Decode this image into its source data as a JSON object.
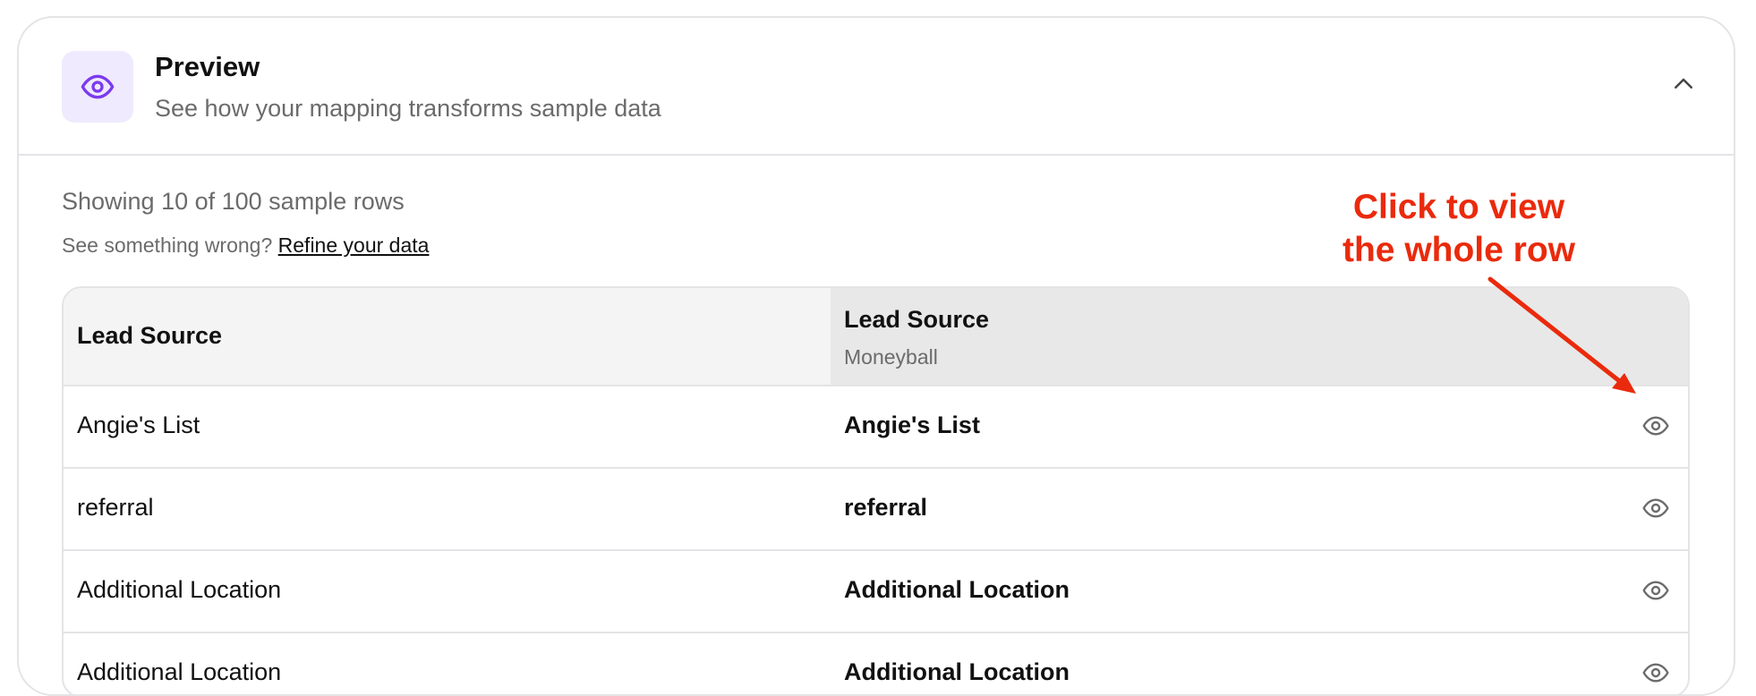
{
  "header": {
    "icon": "eye-icon",
    "title": "Preview",
    "subtitle": "See how your mapping transforms sample data",
    "collapse_icon": "chevron-up-icon"
  },
  "summary": {
    "showing": "Showing 10 of 100 sample rows",
    "wrong_prefix": "See something wrong?",
    "refine_link": "Refine your data"
  },
  "annotation": {
    "line1": "Click to view",
    "line2": "the whole row",
    "color": "#ea2a0c"
  },
  "table": {
    "source_header": "Lead Source",
    "target_header": "Lead Source",
    "target_subheader": "Moneyball",
    "row_action_icon": "eye-icon",
    "rows": [
      {
        "source": "Angie's List",
        "target": "Angie's List"
      },
      {
        "source": "referral",
        "target": "referral"
      },
      {
        "source": "Additional Location",
        "target": "Additional Location"
      },
      {
        "source": "Additional Location",
        "target": "Additional Location"
      }
    ]
  },
  "colors": {
    "accent": "#7c3aed",
    "accent_bg": "#efeafe",
    "annotation": "#ea2a0c"
  }
}
